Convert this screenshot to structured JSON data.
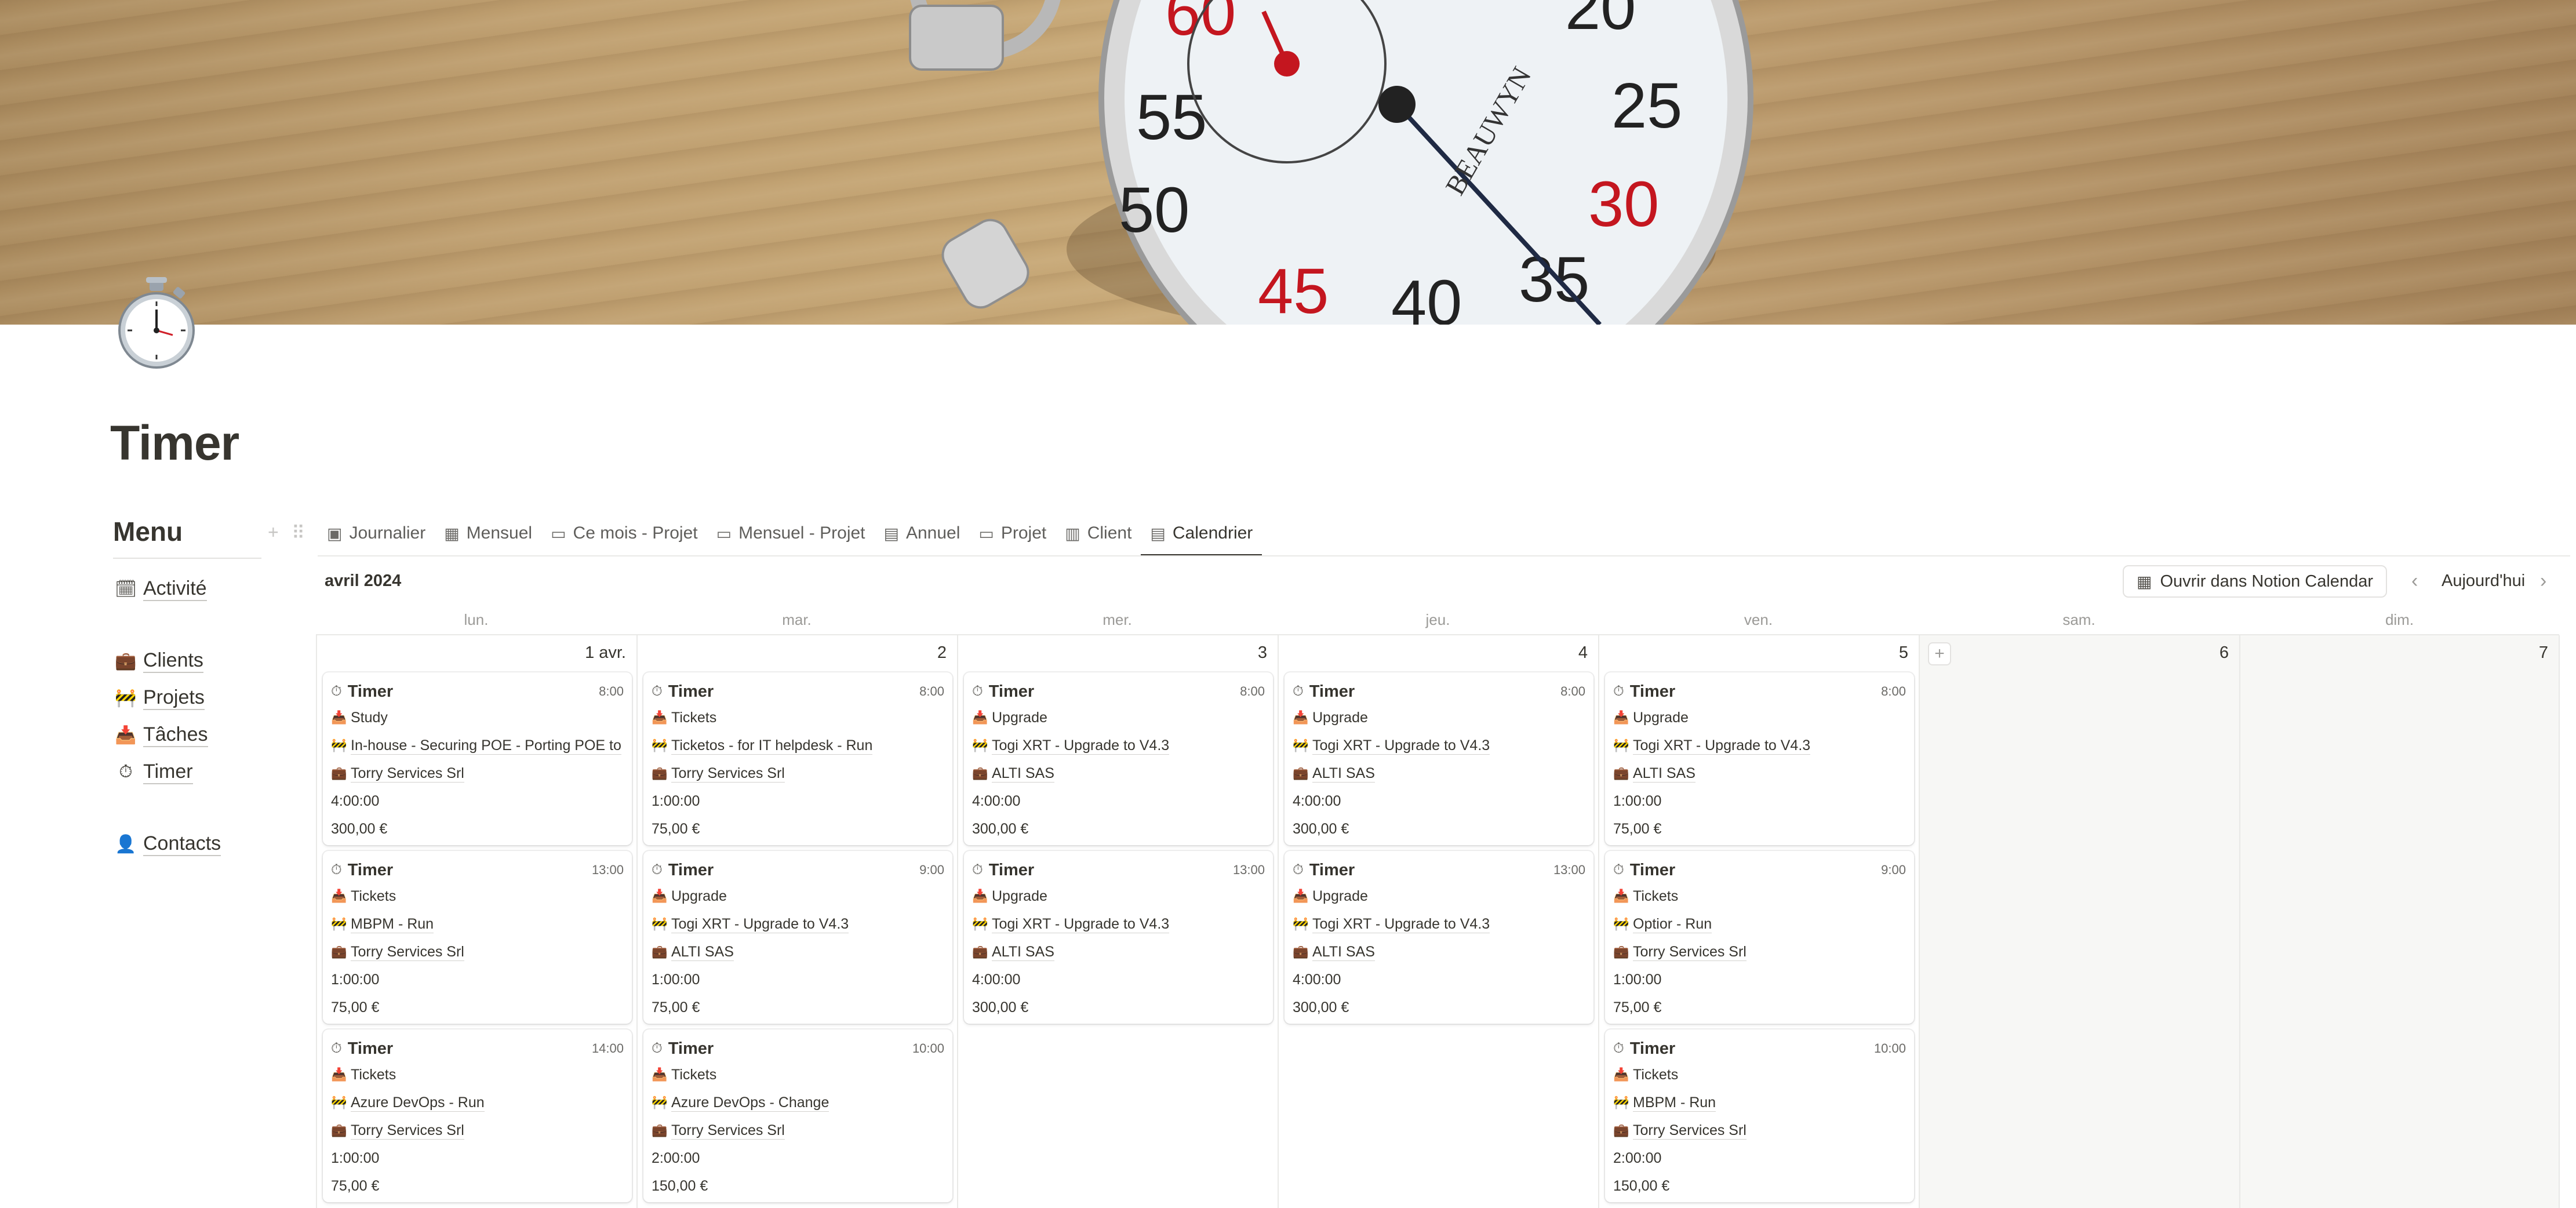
{
  "page": {
    "title": "Timer"
  },
  "menu": {
    "title": "Menu",
    "items": [
      {
        "icon": "activity-icon",
        "emoji": "🗓",
        "label": "Activité"
      },
      {
        "icon": "briefcase-icon",
        "emoji": "💼",
        "label": "Clients"
      },
      {
        "icon": "construction-icon",
        "emoji": "🚧",
        "label": "Projets"
      },
      {
        "icon": "inbox-tray-icon",
        "emoji": "📥",
        "label": "Tâches"
      },
      {
        "icon": "stopwatch-icon",
        "emoji": "⏱",
        "label": "Timer"
      },
      {
        "icon": "person-icon",
        "emoji": "👤",
        "label": "Contacts"
      }
    ]
  },
  "tabs": [
    {
      "icon": "calendar-folder-icon",
      "glyph": "▣",
      "label": "Journalier"
    },
    {
      "icon": "table-icon",
      "glyph": "▦",
      "label": "Mensuel"
    },
    {
      "icon": "folder-icon",
      "glyph": "▭",
      "label": "Ce mois - Projet"
    },
    {
      "icon": "folder-icon",
      "glyph": "▭",
      "label": "Mensuel - Projet"
    },
    {
      "icon": "calendar-icon",
      "glyph": "▤",
      "label": "Annuel"
    },
    {
      "icon": "folder-icon",
      "glyph": "▭",
      "label": "Projet"
    },
    {
      "icon": "chart-icon",
      "glyph": "▥",
      "label": "Client"
    },
    {
      "icon": "calendar-icon",
      "glyph": "▤",
      "label": "Calendrier",
      "active": true
    }
  ],
  "calendar": {
    "month": "avril 2024",
    "open_button": "Ouvrir dans Notion Calendar",
    "today_button": "Aujourd'hui",
    "days_of_week": [
      "lun.",
      "mar.",
      "mer.",
      "jeu.",
      "ven.",
      "sam.",
      "dim."
    ],
    "day_numbers": [
      "1 avr.",
      "2",
      "3",
      "4",
      "5",
      "6",
      "7"
    ]
  },
  "events": {
    "mon": [
      {
        "title": "Timer",
        "time": "8:00",
        "task": "Study",
        "project": "In-house - Securing POE - Porting POE to",
        "client": "Torry Services Srl",
        "duration": "4:00:00",
        "amount": "300,00 €"
      },
      {
        "title": "Timer",
        "time": "13:00",
        "task": "Tickets",
        "project": "MBPM - Run",
        "client": "Torry Services Srl",
        "duration": "1:00:00",
        "amount": "75,00 €"
      },
      {
        "title": "Timer",
        "time": "14:00",
        "task": "Tickets",
        "project": "Azure DevOps - Run",
        "client": "Torry Services Srl",
        "duration": "1:00:00",
        "amount": "75,00 €"
      }
    ],
    "tue": [
      {
        "title": "Timer",
        "time": "8:00",
        "task": "Tickets",
        "project": "Ticketos - for IT helpdesk - Run",
        "client": "Torry Services Srl",
        "duration": "1:00:00",
        "amount": "75,00 €"
      },
      {
        "title": "Timer",
        "time": "9:00",
        "task": "Upgrade",
        "project": "Togi XRT - Upgrade to V4.3",
        "client": "ALTI SAS",
        "duration": "1:00:00",
        "amount": "75,00 €"
      },
      {
        "title": "Timer",
        "time": "10:00",
        "task": "Tickets",
        "project": "Azure DevOps - Change",
        "client": "Torry Services Srl",
        "duration": "2:00:00",
        "amount": "150,00 €"
      }
    ],
    "wed": [
      {
        "title": "Timer",
        "time": "8:00",
        "task": "Upgrade",
        "project": "Togi XRT - Upgrade to V4.3",
        "client": "ALTI SAS",
        "duration": "4:00:00",
        "amount": "300,00 €"
      },
      {
        "title": "Timer",
        "time": "13:00",
        "task": "Upgrade",
        "project": "Togi XRT - Upgrade to V4.3",
        "client": "ALTI SAS",
        "duration": "4:00:00",
        "amount": "300,00 €"
      }
    ],
    "thu": [
      {
        "title": "Timer",
        "time": "8:00",
        "task": "Upgrade",
        "project": "Togi XRT - Upgrade to V4.3",
        "client": "ALTI SAS",
        "duration": "4:00:00",
        "amount": "300,00 €"
      },
      {
        "title": "Timer",
        "time": "13:00",
        "task": "Upgrade",
        "project": "Togi XRT - Upgrade to V4.3",
        "client": "ALTI SAS",
        "duration": "4:00:00",
        "amount": "300,00 €"
      }
    ],
    "fri": [
      {
        "title": "Timer",
        "time": "8:00",
        "task": "Upgrade",
        "project": "Togi XRT - Upgrade to V4.3",
        "client": "ALTI SAS",
        "duration": "1:00:00",
        "amount": "75,00 €"
      },
      {
        "title": "Timer",
        "time": "9:00",
        "task": "Tickets",
        "project": "Optior - Run",
        "client": "Torry Services Srl",
        "duration": "1:00:00",
        "amount": "75,00 €"
      },
      {
        "title": "Timer",
        "time": "10:00",
        "task": "Tickets",
        "project": "MBPM - Run",
        "client": "Torry Services Srl",
        "duration": "2:00:00",
        "amount": "150,00 €"
      }
    ]
  },
  "colors": {
    "accent": "#37352f",
    "muted": "#9b9a97",
    "border": "#e9e9e7",
    "weekend_bg": "#f7f7f5",
    "stopwatch_red": "#d0202a"
  }
}
